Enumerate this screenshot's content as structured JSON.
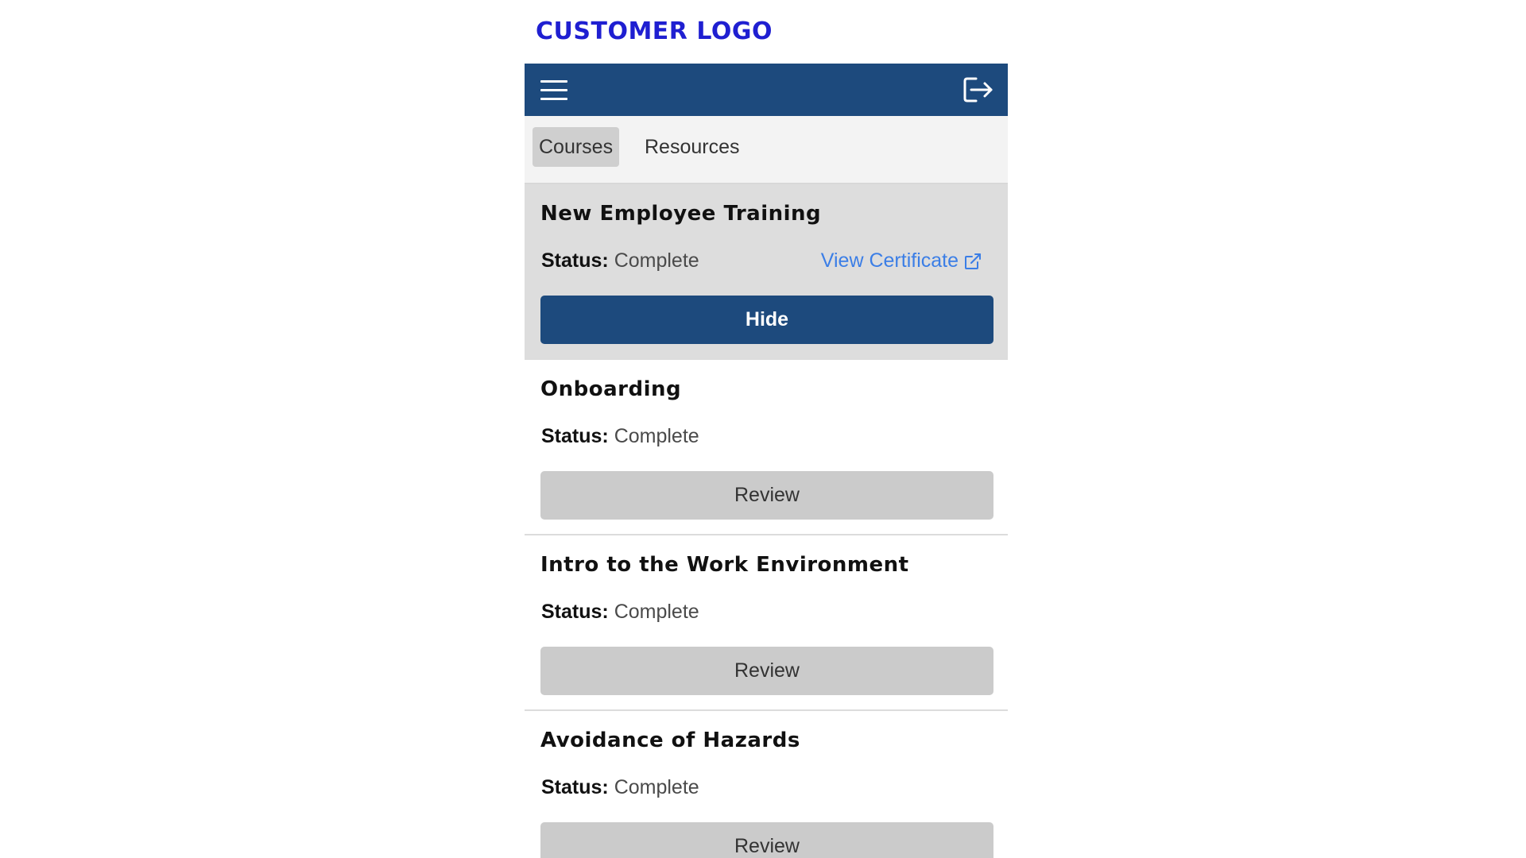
{
  "header": {
    "logo_text": "CUSTOMER LOGO",
    "menu_icon": "hamburger-menu-icon",
    "logout_icon": "logout-icon"
  },
  "tabs": [
    {
      "label": "Courses",
      "active": true
    },
    {
      "label": "Resources",
      "active": false
    }
  ],
  "courses": [
    {
      "title": "New Employee Training",
      "status_label": "Status:",
      "status_value": "Complete",
      "certificate_link": "View Certificate",
      "button_label": "Hide"
    },
    {
      "title": "Onboarding",
      "status_label": "Status:",
      "status_value": "Complete",
      "button_label": "Review"
    },
    {
      "title": "Intro to the Work Environment",
      "status_label": "Status:",
      "status_value": "Complete",
      "button_label": "Review"
    },
    {
      "title": "Avoidance of Hazards",
      "status_label": "Status:",
      "status_value": "Complete",
      "button_label": "Review"
    }
  ],
  "colors": {
    "brand_blue": "#1d4a7d",
    "logo_blue": "#1f1fd1",
    "link_blue": "#3b7ee6",
    "expanded_bg": "#dddddd",
    "secondary_button": "#cbcbcb"
  }
}
